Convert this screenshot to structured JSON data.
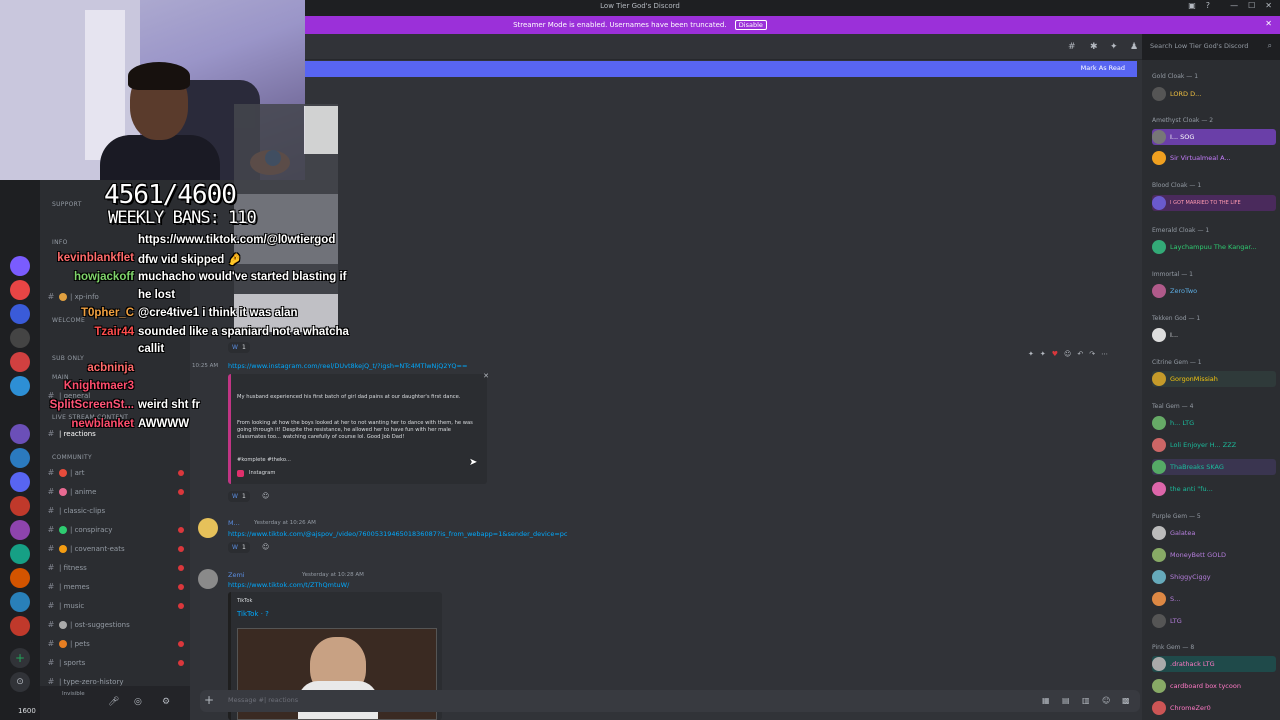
{
  "window": {
    "title": "Low Tier God's Discord"
  },
  "banner": {
    "message": "Streamer Mode is enabled. Usernames have been truncated.",
    "button": "Disable"
  },
  "search": {
    "placeholder": "Search Low Tier God's Discord"
  },
  "mark_read": "Mark As Read",
  "sidebar": {
    "categories": [
      {
        "label": "SUPPORT"
      },
      {
        "label": "INFO"
      },
      {
        "label": "WELCOME"
      },
      {
        "label": "SUB ONLY"
      },
      {
        "label": "MAIN"
      },
      {
        "label": "LIVE STREAM CONTENT"
      },
      {
        "label": "COMMUNITY"
      }
    ],
    "channels": [
      {
        "name": "| xp-info",
        "unread": false
      },
      {
        "name": "| general",
        "unread": false
      },
      {
        "name": "| reactions",
        "unread": false
      },
      {
        "name": "| art",
        "unread": true
      },
      {
        "name": "| anime",
        "unread": true
      },
      {
        "name": "| classic-clips",
        "unread": false
      },
      {
        "name": "| conspiracy",
        "unread": true
      },
      {
        "name": "| covenant-eats",
        "unread": true
      },
      {
        "name": "| fitness",
        "unread": true
      },
      {
        "name": "| memes",
        "unread": true
      },
      {
        "name": "| music",
        "unread": true
      },
      {
        "name": "| ost-suggestions",
        "unread": false
      },
      {
        "name": "| pets",
        "unread": true
      },
      {
        "name": "| sports",
        "unread": true
      },
      {
        "name": "| type-zero-history",
        "unread": false
      }
    ],
    "user_status": "Invisible",
    "user_tag": "1600"
  },
  "messages": {
    "m1": {
      "link": "https://www.instagram.com/reel/DUvt8kejQ_t/?igsh=NTc4MTlwNjQ2YQ==",
      "time": "10:25 AM",
      "embed_line1": "My husband experienced his first batch of girl dad pains at our daughter's first dance.",
      "embed_line2": "From looking at how the boys looked at her to not wanting her to dance with them, he was going through it! Despite the resistance, he allowed her to have fun with her male classmates too... watching carefully of course lol. Good Job Dad!",
      "embed_tags": "#komplete #theko...",
      "embed_source": "Instagram",
      "reaction_count": "1"
    },
    "m2": {
      "author": "M...",
      "time": "Yesterday at 10:26 AM",
      "link": "https://www.tiktok.com/@ajspov_/video/7600531946501836087?is_from_webapp=1&sender_device=pc",
      "reaction_count": "1"
    },
    "m3": {
      "author": "Zemi",
      "time": "Yesterday at 10:28 AM",
      "link": "https://www.tiktok.com/t/ZThQmtuW/",
      "embed_provider": "TikTok",
      "embed_title": "TikTok · ?"
    },
    "m0": {
      "reaction_count": "1"
    }
  },
  "composer": {
    "placeholder": "Message #| reactions"
  },
  "members": {
    "groups": [
      {
        "role": "Gold Cloak — 1",
        "members": [
          {
            "name": "LORD D...",
            "color": "#f0c040"
          }
        ]
      },
      {
        "role": "Amethyst Cloak — 2",
        "members": [
          {
            "name": "I... SOG",
            "color": "#c77dff"
          },
          {
            "name": "Sir Virtualmeal A...",
            "color": "#c77dff"
          }
        ]
      },
      {
        "role": "Blood Cloak — 1",
        "members": [
          {
            "name": "I GOT MARRIED TO THE LIFE",
            "color": "#ff4d6d"
          }
        ]
      },
      {
        "role": "Emerald Cloak — 1",
        "members": [
          {
            "name": "Laychampuu The Kangar...",
            "color": "#2ecc71"
          }
        ]
      },
      {
        "role": "Immortal — 1",
        "members": [
          {
            "name": "ZeroTwo",
            "color": "#5dade2"
          }
        ]
      },
      {
        "role": "Tekken God — 1",
        "members": [
          {
            "name": "I...",
            "color": "#dbdee1"
          }
        ]
      },
      {
        "role": "Citrine Gem — 1",
        "members": [
          {
            "name": "GorgonMissiah",
            "color": "#f1c40f"
          }
        ]
      },
      {
        "role": "Teal Gem — 4",
        "members": [
          {
            "name": "h... LTG",
            "color": "#1abc9c"
          },
          {
            "name": "Loli Enjoyer H... ZZZ",
            "color": "#1abc9c"
          },
          {
            "name": "ThaBreaks SKAG",
            "color": "#1abc9c"
          },
          {
            "name": "the anti \"fu...",
            "color": "#1abc9c"
          }
        ]
      },
      {
        "role": "Purple Gem — 5",
        "members": [
          {
            "name": "Galatea",
            "color": "#b57edc"
          },
          {
            "name": "MoneyBett GOLD",
            "color": "#b57edc"
          },
          {
            "name": "ShiggyCiggy",
            "color": "#b57edc"
          },
          {
            "name": "S...",
            "color": "#b57edc"
          },
          {
            "name": "LTG",
            "color": "#b57edc"
          }
        ]
      },
      {
        "role": "Pink Gem — 8",
        "members": [
          {
            "name": ".drathack LTG",
            "color": "#ff79c6"
          },
          {
            "name": "cardboard box tycoon",
            "color": "#ff79c6"
          },
          {
            "name": "ChromeZer0",
            "color": "#ff79c6"
          }
        ]
      }
    ]
  },
  "stream": {
    "counter": "4561/4600",
    "weekly": "WEEKLY BANS: 110",
    "chat": [
      {
        "user": "",
        "text": "https://www.tiktok.com/@l0wtiergod",
        "color": "#ffffff"
      },
      {
        "user": "kevinblankflet",
        "text": "dfw vid skipped 🤌",
        "color": "#ff6b6b"
      },
      {
        "user": "howjackoff",
        "text": "muchacho would've started blasting if",
        "color": "#7fd46b"
      },
      {
        "user": "",
        "text": "he lost",
        "color": "#ffffff"
      },
      {
        "user": "T0pher_C",
        "text": "@cre4tive1 i think it was alan",
        "color": "#f0a040"
      },
      {
        "user": "Tzair44",
        "text": "sounded like a spaniard not a whatcha",
        "color": "#ff4d4d"
      },
      {
        "user": "",
        "text": "callit",
        "color": "#ffffff"
      },
      {
        "user": "acbninja",
        "text": "",
        "color": "#ff6b6b"
      },
      {
        "user": "Knightmaer3",
        "text": "",
        "color": "#ff4d6d"
      },
      {
        "user": "SplitScreenSt...",
        "text": "weird sht fr",
        "color": "#ff5577"
      },
      {
        "user": "newblanket",
        "text": "AWWWW",
        "color": "#ff4d6d"
      }
    ]
  }
}
